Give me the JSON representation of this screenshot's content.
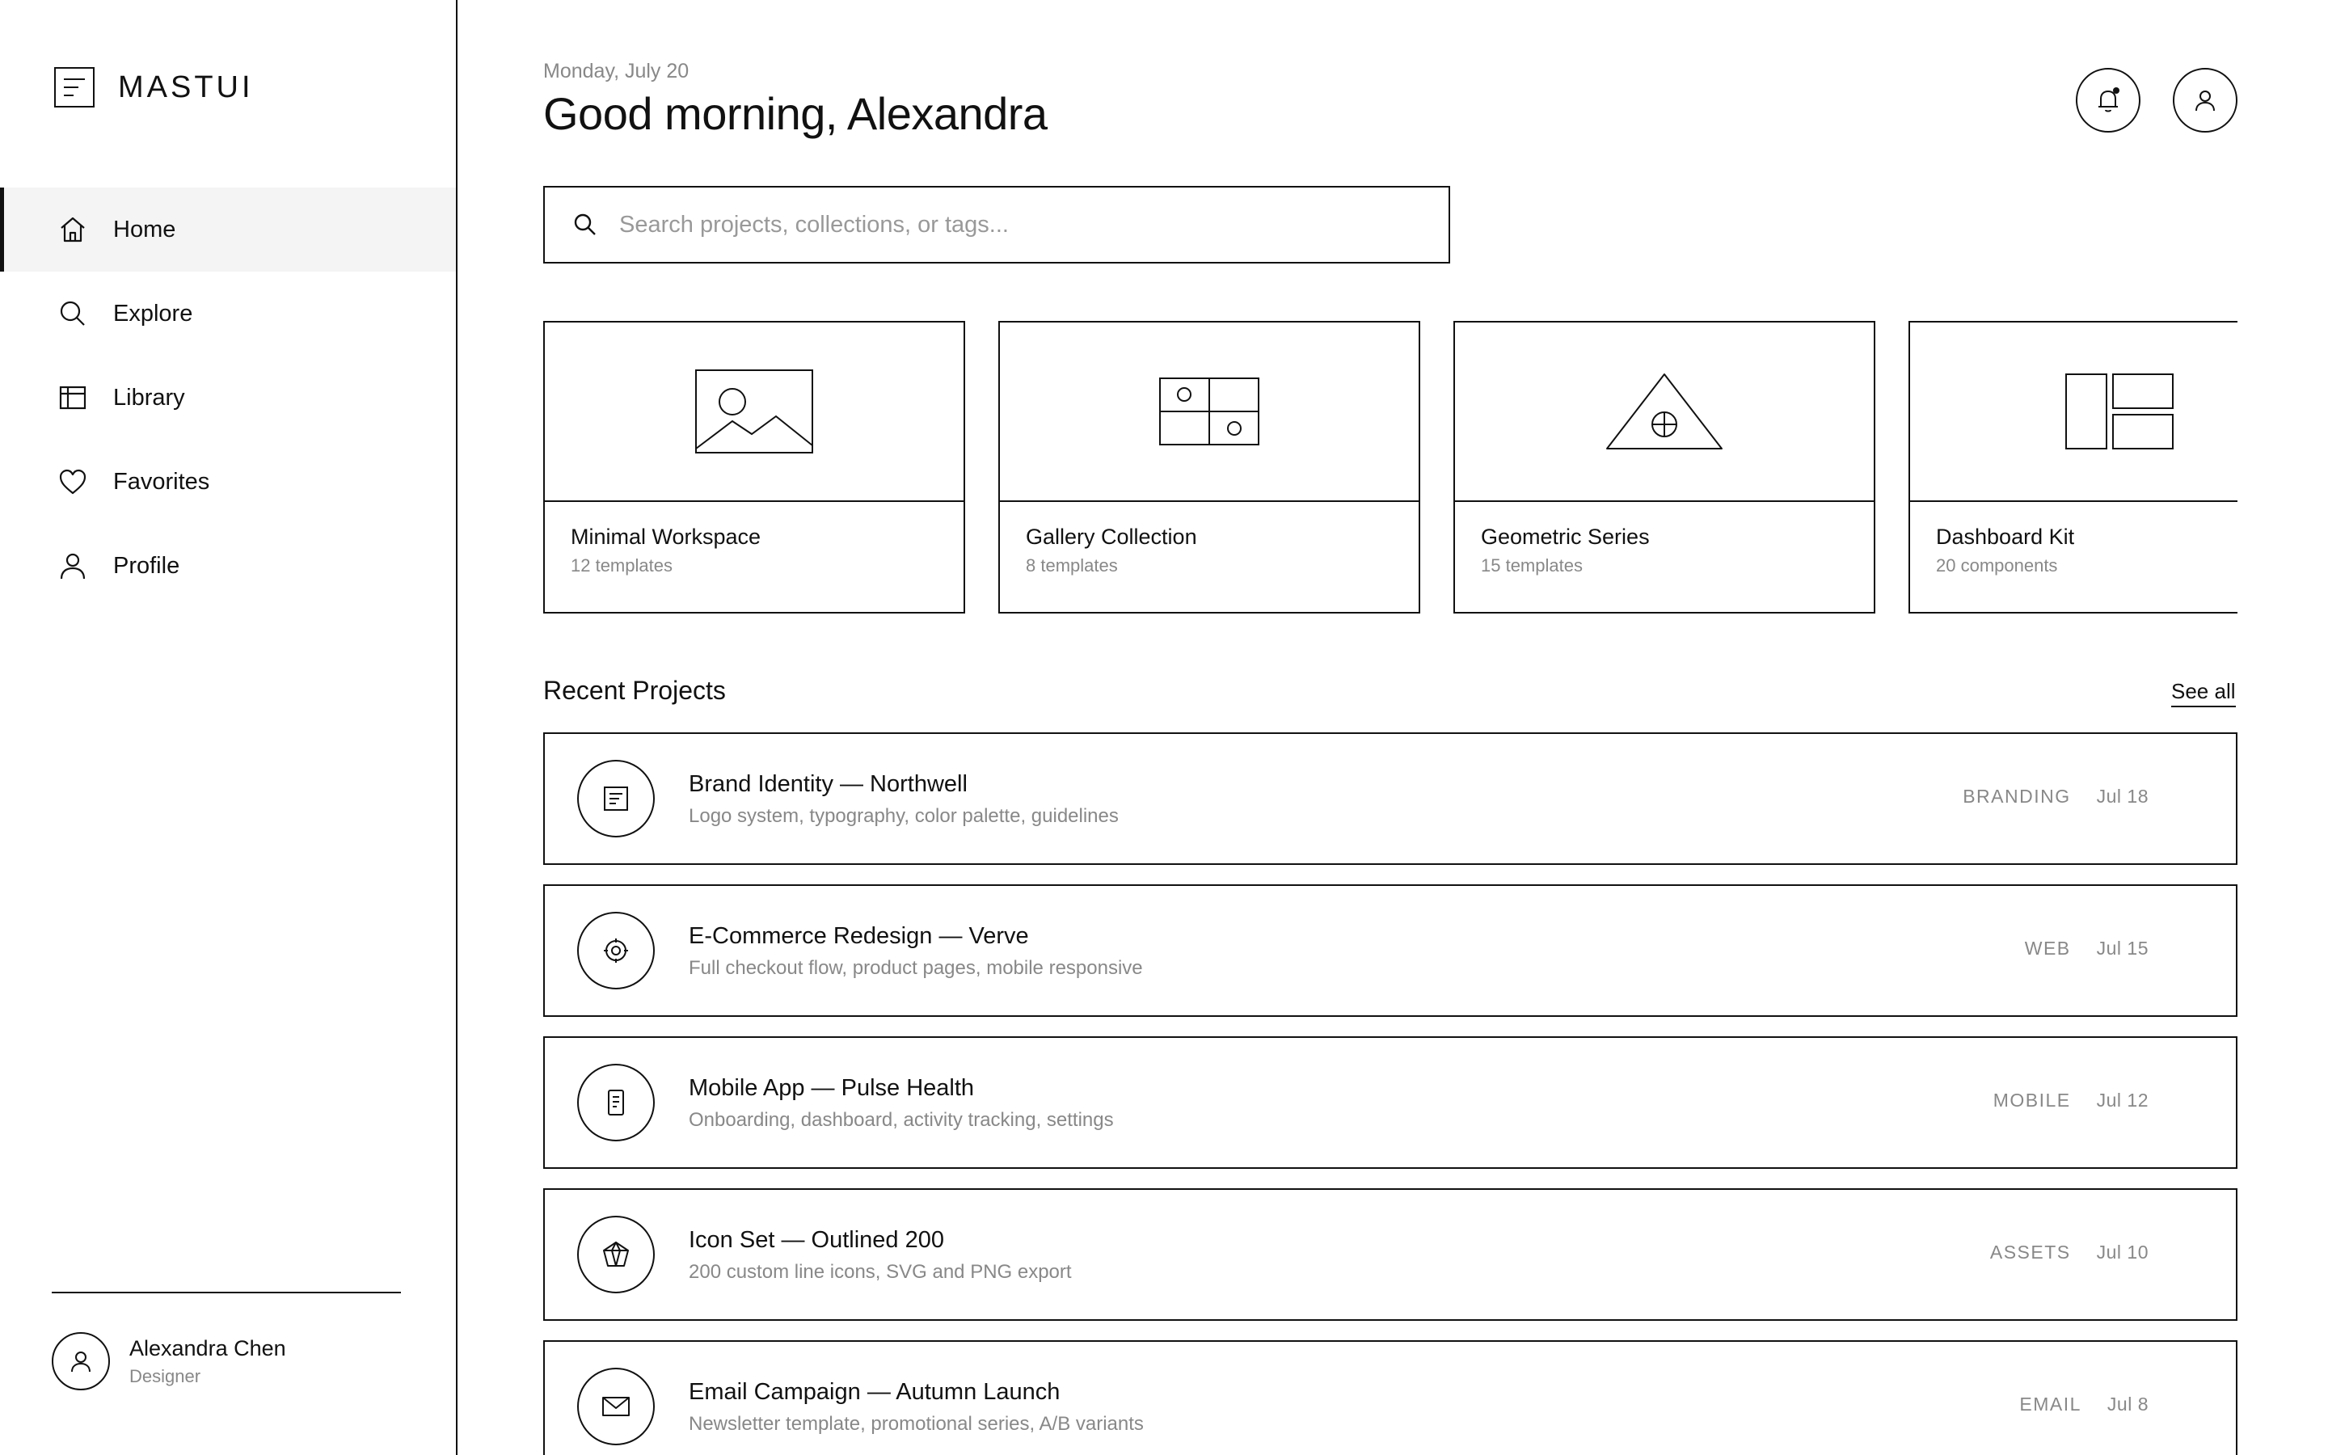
{
  "brand": {
    "name": "MASTUI",
    "logo_icon": "document-lines-icon"
  },
  "sidebar": {
    "items": [
      {
        "label": "Home",
        "icon": "home-icon",
        "active": true
      },
      {
        "label": "Explore",
        "icon": "search-icon",
        "active": false
      },
      {
        "label": "Library",
        "icon": "library-grid-icon",
        "active": false
      },
      {
        "label": "Favorites",
        "icon": "heart-icon",
        "active": false
      },
      {
        "label": "Profile",
        "icon": "user-icon",
        "active": false
      }
    ],
    "user": {
      "name": "Alexandra Chen",
      "role": "Designer"
    }
  },
  "header": {
    "date": "Monday, July 20",
    "greeting": "Good morning, Alexandra",
    "notification_icon": "bell-icon",
    "account_icon": "user-icon"
  },
  "search": {
    "placeholder": "Search projects, collections, or tags...",
    "value": ""
  },
  "collections": [
    {
      "title": "Minimal Workspace",
      "subtitle": "12 templates",
      "icon": "image-landscape-icon"
    },
    {
      "title": "Gallery Collection",
      "subtitle": "8 templates",
      "icon": "grid-gallery-icon"
    },
    {
      "title": "Geometric Series",
      "subtitle": "15 templates",
      "icon": "triangle-crosshair-icon"
    },
    {
      "title": "Dashboard Kit",
      "subtitle": "20 components",
      "icon": "layout-panels-icon"
    }
  ],
  "recent": {
    "title": "Recent Projects",
    "see_all": "See all",
    "projects": [
      {
        "title": "Brand Identity — Northwell",
        "subtitle": "Logo system, typography, color palette, guidelines",
        "tag": "BRANDING",
        "date": "Jul 18",
        "icon": "document-icon"
      },
      {
        "title": "E-Commerce Redesign — Verve",
        "subtitle": "Full checkout flow, product pages, mobile responsive",
        "tag": "WEB",
        "date": "Jul 15",
        "icon": "target-icon"
      },
      {
        "title": "Mobile App — Pulse Health",
        "subtitle": "Onboarding, dashboard, activity tracking, settings",
        "tag": "MOBILE",
        "date": "Jul 12",
        "icon": "phone-icon"
      },
      {
        "title": "Icon Set — Outlined 200",
        "subtitle": "200 custom line icons, SVG and PNG export",
        "tag": "ASSETS",
        "date": "Jul 10",
        "icon": "gem-icon"
      },
      {
        "title": "Email Campaign — Autumn Launch",
        "subtitle": "Newsletter template, promotional series, A/B variants",
        "tag": "EMAIL",
        "date": "Jul 8",
        "icon": "mail-icon"
      }
    ]
  }
}
